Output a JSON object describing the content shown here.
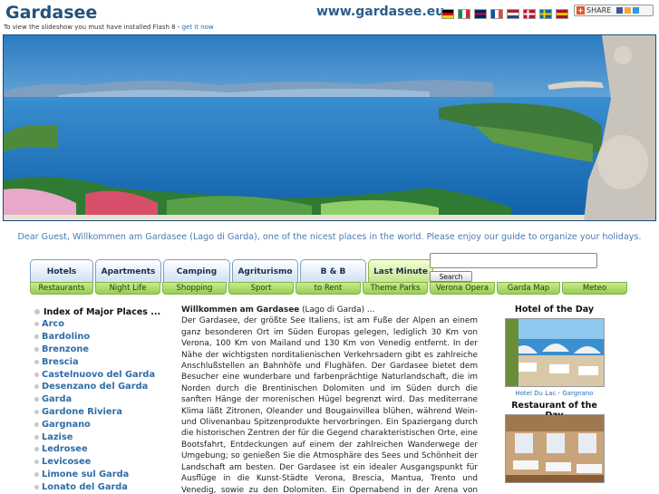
{
  "header": {
    "title": "Gardasee",
    "url": "www.gardasee.eu",
    "flags": [
      {
        "name": "german-flag-icon",
        "colors": [
          "#000000",
          "#dd0000",
          "#ffce00"
        ],
        "orient": "h"
      },
      {
        "name": "italian-flag-icon",
        "colors": [
          "#009246",
          "#ffffff",
          "#ce2b37"
        ],
        "orient": "v"
      },
      {
        "name": "uk-flag-icon",
        "colors": [
          "#012169",
          "#ffffff",
          "#c8102e"
        ],
        "orient": "uk"
      },
      {
        "name": "french-flag-icon",
        "colors": [
          "#0055a4",
          "#ffffff",
          "#ef4135"
        ],
        "orient": "v"
      },
      {
        "name": "dutch-flag-icon",
        "colors": [
          "#ae1c28",
          "#ffffff",
          "#21468b"
        ],
        "orient": "h"
      },
      {
        "name": "danish-flag-icon",
        "colors": [
          "#c60c30",
          "#ffffff"
        ],
        "orient": "cross"
      },
      {
        "name": "swedish-flag-icon",
        "colors": [
          "#006aa7",
          "#fecc00"
        ],
        "orient": "cross"
      },
      {
        "name": "spanish-flag-icon",
        "colors": [
          "#aa151b",
          "#f1bf00",
          "#aa151b"
        ],
        "orient": "h"
      }
    ],
    "share_label": "SHARE"
  },
  "flash_note": {
    "text": "To view the slideshow you must have installed Flash 8 -",
    "link": "get it now"
  },
  "welcome": "Dear Guest, Willkommen am Gardasee (Lago di Garda), one of the nicest places in the world. Please enjoy our guide to organize your holidays.",
  "nav": {
    "top": [
      "Hotels",
      "Apartments",
      "Camping",
      "Agriturismo",
      "B & B",
      "Last Minute"
    ],
    "bottom": [
      "Restaurants",
      "Night Life",
      "Shopping",
      "Sport",
      "to Rent",
      "Theme Parks",
      "Verona Opera",
      "Garda Map",
      "Meteo"
    ]
  },
  "search": {
    "value": "",
    "button_label": "Search"
  },
  "index": {
    "title": "Index of Major Places ...",
    "places": [
      "Arco",
      "Bardolino",
      "Brenzone",
      "Brescia",
      "Castelnuovo del Garda",
      "Desenzano del Garda",
      "Garda",
      "Gardone Riviera",
      "Gargnano",
      "Lazise",
      "Ledrosee",
      "Levicosee",
      "Limone sul Garda",
      "Lonato del Garda"
    ]
  },
  "article": {
    "title": "Willkommen am Gardasee",
    "subtitle": "(Lago di Garda) ...",
    "body": "Der Gardasee, der größte See Italiens, ist am Fuße der Alpen an einem ganz besonderen Ort im Süden Europas gelegen, lediglich 30 Km von Verona, 100 Km von Mailand und 130 Km von Venedig entfernt. In der Nähe der wichtigsten norditalienischen Verkehrsadern gibt es zahlreiche Anschlußstellen an Bahnhöfe und Flughäfen. Der Gardasee bietet dem Besucher eine wunderbare und farbenprächtige Naturlandschaft, die im Norden durch die Brentinischen Dolomiten und im Süden durch die sanften Hänge der morenischen Hügel begrenzt wird. Das mediterrane Klima läßt Zitronen, Oleander und Bougainvillea blühen, während Wein- und Olivenanbau Spitzenprodukte hervorbringen. Ein Spaziergang durch die historischen Zentren der für die Gegend charakteristischen Orte, eine Bootsfahrt, Entdeckungen auf einem der zahlreichen Wanderwege der Umgebung; so genießen Sie die Atmosphäre des Sees und Schönheit der Landschaft am besten. Der Gardasee ist ein idealer Ausgangspunkt für Ausflüge in die Kunst-Städte Verona, Brescia, Mantua, Trento und Venedig, sowie zu den Dolomiten. Ein Opernabend in der Arena von Verona darf dabei"
  },
  "right": {
    "hotel_title": "Hotel of the Day",
    "hotel_caption": "Hotel Du Lac - Gargnano",
    "restaurant_title": "Restaurant of the Day"
  },
  "colors": {
    "title": "#23527c",
    "link": "#2f6da8",
    "tab_blue": "#cfe0f1",
    "tab_green": "#98cd52"
  }
}
